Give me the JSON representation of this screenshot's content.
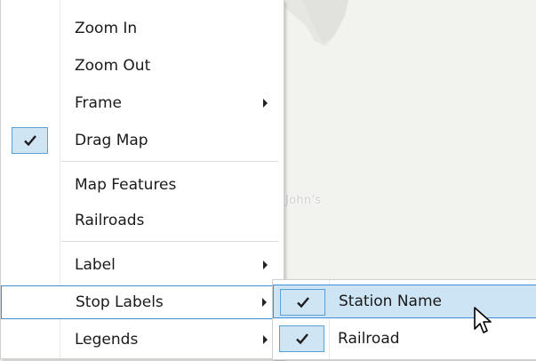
{
  "map": {
    "place_label": "John's"
  },
  "context_menu": {
    "items": [
      {
        "label": "Zoom In"
      },
      {
        "label": "Zoom Out"
      },
      {
        "label": "Frame",
        "has_submenu": true
      },
      {
        "label": "Drag Map",
        "checked": true
      },
      {
        "label": "Map Features"
      },
      {
        "label": "Railroads"
      },
      {
        "label": "Label",
        "has_submenu": true
      },
      {
        "label": "Stop Labels",
        "has_submenu": true,
        "state": "open"
      },
      {
        "label": "Legends",
        "has_submenu": true
      }
    ]
  },
  "submenu": {
    "items": [
      {
        "label": "Station Name",
        "checked": true,
        "state": "hover"
      },
      {
        "label": "Railroad",
        "checked": true
      }
    ]
  },
  "colors": {
    "accent_border": "#3c8fd4",
    "highlight_fill": "#cde4f5",
    "check_fill": "#cfe5f4"
  }
}
